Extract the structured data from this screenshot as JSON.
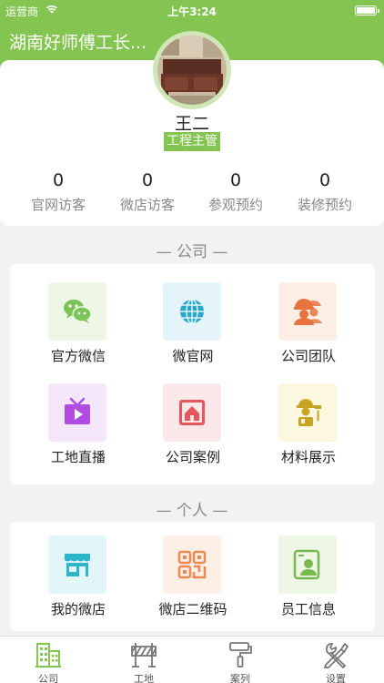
{
  "status_bar": {
    "carrier": "运营商",
    "time": "上午3:24"
  },
  "header": {
    "title": "湖南好师傅工长..."
  },
  "profile": {
    "name": "王二",
    "role": "工程主管"
  },
  "stats": [
    {
      "value": "0",
      "label": "官网访客"
    },
    {
      "value": "0",
      "label": "微店访客"
    },
    {
      "value": "0",
      "label": "参观预约"
    },
    {
      "value": "0",
      "label": "装修预约"
    }
  ],
  "company_section": {
    "title": "— 公司 —",
    "items": [
      {
        "label": "官方微信",
        "icon": "wechat-icon"
      },
      {
        "label": "微官网",
        "icon": "globe-icon"
      },
      {
        "label": "公司团队",
        "icon": "team-icon"
      },
      {
        "label": "工地直播",
        "icon": "tv-icon"
      },
      {
        "label": "公司案例",
        "icon": "house-icon"
      },
      {
        "label": "材料展示",
        "icon": "worker-icon"
      }
    ]
  },
  "personal_section": {
    "title": "— 个人 —",
    "items": [
      {
        "label": "我的微店",
        "icon": "shop-icon"
      },
      {
        "label": "微店二维码",
        "icon": "qrcode-icon"
      },
      {
        "label": "员工信息",
        "icon": "employee-icon"
      }
    ]
  },
  "tabbar": {
    "active": "公司",
    "items": [
      {
        "label": "公司",
        "icon": "building-icon"
      },
      {
        "label": "工地",
        "icon": "barrier-icon"
      },
      {
        "label": "案列",
        "icon": "paint-roller-icon"
      },
      {
        "label": "设置",
        "icon": "tools-icon"
      }
    ]
  },
  "colors": {
    "brand": "#84c451",
    "wechat": "#7cc35a",
    "globe": "#26a7c9",
    "team": "#e8733f",
    "tv": "#b04ce3",
    "house": "#e5565e",
    "worker": "#c9a423",
    "shop": "#2bb7c9",
    "qrcode": "#e98a55",
    "employee": "#79b851"
  }
}
